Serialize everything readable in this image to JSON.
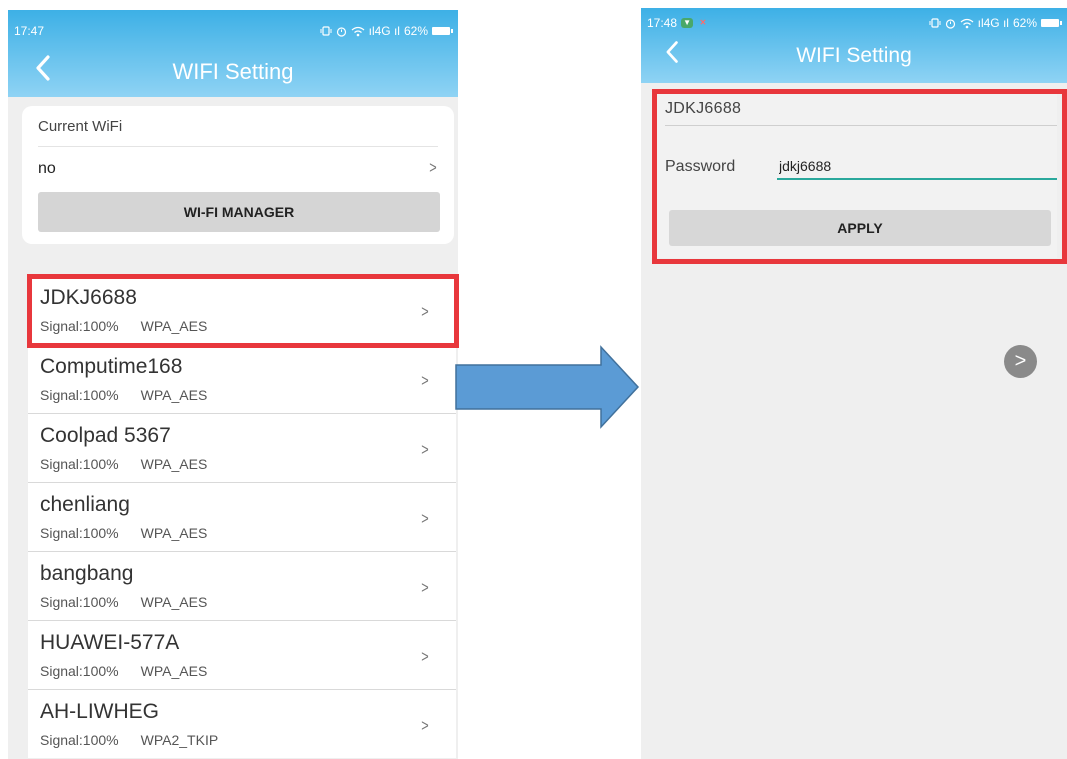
{
  "left_screen": {
    "status_bar": {
      "time": "17:47",
      "signal_text": "ıl4G ıl",
      "battery": "62%"
    },
    "title": "WIFI Setting",
    "current_wifi": {
      "label": "Current WiFi",
      "value": "no",
      "button": "WI-FI MANAGER"
    },
    "networks": [
      {
        "name": "JDKJ6688",
        "signal": "Signal:100%",
        "security": "WPA_AES"
      },
      {
        "name": "Computime168",
        "signal": "Signal:100%",
        "security": "WPA_AES"
      },
      {
        "name": "Coolpad 5367",
        "signal": "Signal:100%",
        "security": "WPA_AES"
      },
      {
        "name": "chenliang",
        "signal": "Signal:100%",
        "security": "WPA_AES"
      },
      {
        "name": "bangbang",
        "signal": "Signal:100%",
        "security": "WPA_AES"
      },
      {
        "name": "HUAWEI-577A",
        "signal": "Signal:100%",
        "security": "WPA_AES"
      },
      {
        "name": "AH-LIWHEG",
        "signal": "Signal:100%",
        "security": "WPA2_TKIP"
      }
    ]
  },
  "right_screen": {
    "status_bar": {
      "time": "17:48",
      "signal_text": "ıl4G ıl",
      "battery": "62%"
    },
    "title": "WIFI Setting",
    "form": {
      "ssid": "JDKJ6688",
      "password_label": "Password",
      "password_value": "jdkj6688",
      "apply_button": "APPLY"
    },
    "next_symbol": ">"
  },
  "chevron": ">",
  "colors": {
    "header_gradient_top": "#3db0e6",
    "header_gradient_bottom": "#8fd3f4",
    "highlight": "#e8373c",
    "arrow_fill": "#5b9bd5",
    "arrow_stroke": "#41719c",
    "input_underline": "#2aa89c"
  },
  "icons": [
    "back-arrow-icon",
    "wifi-icon",
    "battery-icon",
    "chevron-right-icon",
    "right-arrow-icon"
  ]
}
